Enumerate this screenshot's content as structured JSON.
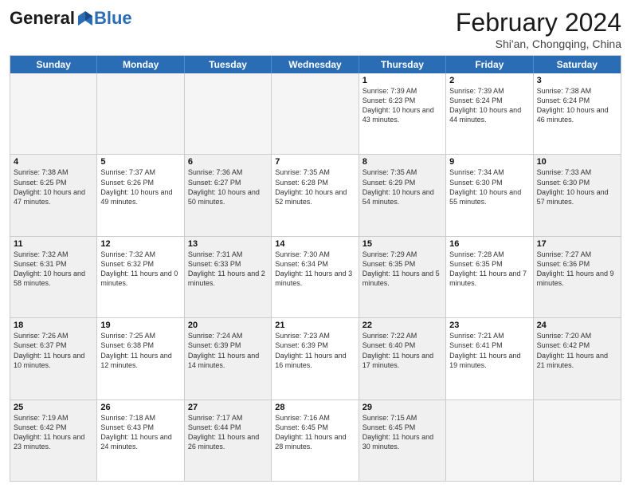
{
  "header": {
    "logo_general": "General",
    "logo_blue": "Blue",
    "month_title": "February 2024",
    "subtitle": "Shi'an, Chongqing, China"
  },
  "weekdays": [
    "Sunday",
    "Monday",
    "Tuesday",
    "Wednesday",
    "Thursday",
    "Friday",
    "Saturday"
  ],
  "rows": [
    [
      {
        "day": "",
        "text": "",
        "empty": true
      },
      {
        "day": "",
        "text": "",
        "empty": true
      },
      {
        "day": "",
        "text": "",
        "empty": true
      },
      {
        "day": "",
        "text": "",
        "empty": true
      },
      {
        "day": "1",
        "text": "Sunrise: 7:39 AM\nSunset: 6:23 PM\nDaylight: 10 hours\nand 43 minutes."
      },
      {
        "day": "2",
        "text": "Sunrise: 7:39 AM\nSunset: 6:24 PM\nDaylight: 10 hours\nand 44 minutes."
      },
      {
        "day": "3",
        "text": "Sunrise: 7:38 AM\nSunset: 6:24 PM\nDaylight: 10 hours\nand 46 minutes."
      }
    ],
    [
      {
        "day": "4",
        "text": "Sunrise: 7:38 AM\nSunset: 6:25 PM\nDaylight: 10 hours\nand 47 minutes.",
        "shaded": true
      },
      {
        "day": "5",
        "text": "Sunrise: 7:37 AM\nSunset: 6:26 PM\nDaylight: 10 hours\nand 49 minutes."
      },
      {
        "day": "6",
        "text": "Sunrise: 7:36 AM\nSunset: 6:27 PM\nDaylight: 10 hours\nand 50 minutes.",
        "shaded": true
      },
      {
        "day": "7",
        "text": "Sunrise: 7:35 AM\nSunset: 6:28 PM\nDaylight: 10 hours\nand 52 minutes."
      },
      {
        "day": "8",
        "text": "Sunrise: 7:35 AM\nSunset: 6:29 PM\nDaylight: 10 hours\nand 54 minutes.",
        "shaded": true
      },
      {
        "day": "9",
        "text": "Sunrise: 7:34 AM\nSunset: 6:30 PM\nDaylight: 10 hours\nand 55 minutes."
      },
      {
        "day": "10",
        "text": "Sunrise: 7:33 AM\nSunset: 6:30 PM\nDaylight: 10 hours\nand 57 minutes.",
        "shaded": true
      }
    ],
    [
      {
        "day": "11",
        "text": "Sunrise: 7:32 AM\nSunset: 6:31 PM\nDaylight: 10 hours\nand 58 minutes.",
        "shaded": true
      },
      {
        "day": "12",
        "text": "Sunrise: 7:32 AM\nSunset: 6:32 PM\nDaylight: 11 hours\nand 0 minutes."
      },
      {
        "day": "13",
        "text": "Sunrise: 7:31 AM\nSunset: 6:33 PM\nDaylight: 11 hours\nand 2 minutes.",
        "shaded": true
      },
      {
        "day": "14",
        "text": "Sunrise: 7:30 AM\nSunset: 6:34 PM\nDaylight: 11 hours\nand 3 minutes."
      },
      {
        "day": "15",
        "text": "Sunrise: 7:29 AM\nSunset: 6:35 PM\nDaylight: 11 hours\nand 5 minutes.",
        "shaded": true
      },
      {
        "day": "16",
        "text": "Sunrise: 7:28 AM\nSunset: 6:35 PM\nDaylight: 11 hours\nand 7 minutes."
      },
      {
        "day": "17",
        "text": "Sunrise: 7:27 AM\nSunset: 6:36 PM\nDaylight: 11 hours\nand 9 minutes.",
        "shaded": true
      }
    ],
    [
      {
        "day": "18",
        "text": "Sunrise: 7:26 AM\nSunset: 6:37 PM\nDaylight: 11 hours\nand 10 minutes.",
        "shaded": true
      },
      {
        "day": "19",
        "text": "Sunrise: 7:25 AM\nSunset: 6:38 PM\nDaylight: 11 hours\nand 12 minutes."
      },
      {
        "day": "20",
        "text": "Sunrise: 7:24 AM\nSunset: 6:39 PM\nDaylight: 11 hours\nand 14 minutes.",
        "shaded": true
      },
      {
        "day": "21",
        "text": "Sunrise: 7:23 AM\nSunset: 6:39 PM\nDaylight: 11 hours\nand 16 minutes."
      },
      {
        "day": "22",
        "text": "Sunrise: 7:22 AM\nSunset: 6:40 PM\nDaylight: 11 hours\nand 17 minutes.",
        "shaded": true
      },
      {
        "day": "23",
        "text": "Sunrise: 7:21 AM\nSunset: 6:41 PM\nDaylight: 11 hours\nand 19 minutes."
      },
      {
        "day": "24",
        "text": "Sunrise: 7:20 AM\nSunset: 6:42 PM\nDaylight: 11 hours\nand 21 minutes.",
        "shaded": true
      }
    ],
    [
      {
        "day": "25",
        "text": "Sunrise: 7:19 AM\nSunset: 6:42 PM\nDaylight: 11 hours\nand 23 minutes.",
        "shaded": true
      },
      {
        "day": "26",
        "text": "Sunrise: 7:18 AM\nSunset: 6:43 PM\nDaylight: 11 hours\nand 24 minutes."
      },
      {
        "day": "27",
        "text": "Sunrise: 7:17 AM\nSunset: 6:44 PM\nDaylight: 11 hours\nand 26 minutes.",
        "shaded": true
      },
      {
        "day": "28",
        "text": "Sunrise: 7:16 AM\nSunset: 6:45 PM\nDaylight: 11 hours\nand 28 minutes."
      },
      {
        "day": "29",
        "text": "Sunrise: 7:15 AM\nSunset: 6:45 PM\nDaylight: 11 hours\nand 30 minutes.",
        "shaded": true
      },
      {
        "day": "",
        "text": "",
        "empty": true
      },
      {
        "day": "",
        "text": "",
        "empty": true
      }
    ]
  ]
}
